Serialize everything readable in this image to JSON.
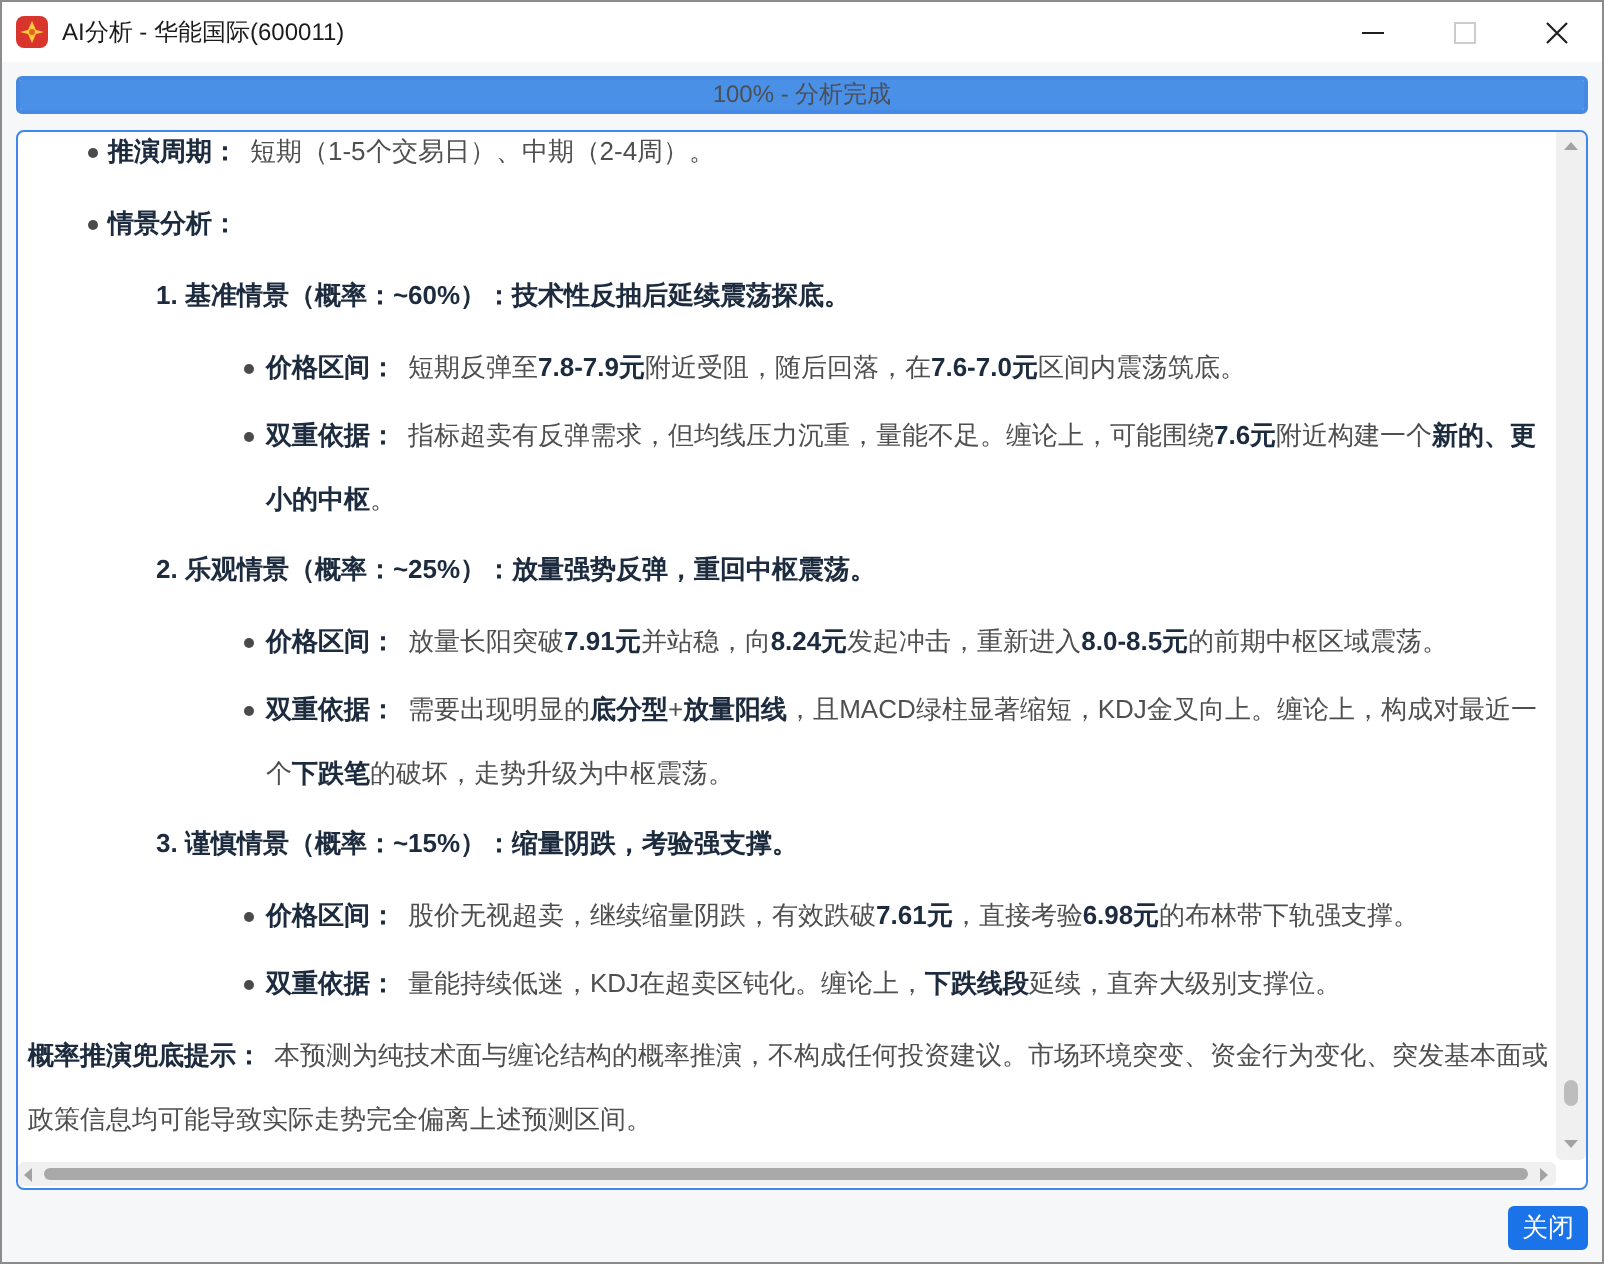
{
  "window": {
    "title": "AI分析 - 华能国际(600011)",
    "controls": [
      {
        "kind": "minimize",
        "disabled": false
      },
      {
        "kind": "maximize",
        "disabled": true
      },
      {
        "kind": "close",
        "disabled": false
      }
    ]
  },
  "progress": {
    "level": 1,
    "label": "100% - 分析完成"
  },
  "report": {
    "items": [
      {
        "label": "推演周期：",
        "text": "短期（1-5个交易日）、中期（2-4周）。"
      },
      {
        "label": "情景分析：",
        "scenarios": [
          {
            "title": "1. 基准情景（概率：~60%）：技术性反抽后延续震荡探底。",
            "points": [
              {
                "label": "价格区间：",
                "text": "短期反弹至**7.8-7.9元**附近受阻，随后回落，在**7.6-7.0元**区间内震荡筑底。"
              },
              {
                "label": "双重依据：",
                "text": "指标超卖有反弹需求，但均线压力沉重，量能不足。缠论上，可能围绕**7.6元**附近构建一个**新的、更小的中枢**。"
              }
            ]
          },
          {
            "title": "2. 乐观情景（概率：~25%）：放量强势反弹，重回中枢震荡。",
            "points": [
              {
                "label": "价格区间：",
                "text": "放量长阳突破**7.91元**并站稳，向**8.24元**发起冲击，重新进入**8.0-8.5元**的前期中枢区域震荡。"
              },
              {
                "label": "双重依据：",
                "text": "需要出现明显的**底分型**+**放量阳线**，且MACD绿柱显著缩短，KDJ金叉向上。缠论上，构成对最近一个**下跌笔**的破坏，走势升级为中枢震荡。"
              }
            ]
          },
          {
            "title": "3. 谨慎情景（概率：~15%）：缩量阴跌，考验强支撑。",
            "points": [
              {
                "label": "价格区间：",
                "text": "股价无视超卖，继续缩量阴跌，有效跌破**7.61元**，直接考验**6.98元**的布林带下轨强支撑。"
              },
              {
                "label": "双重依据：",
                "text": "量能持续低迷，KDJ在超卖区钝化。缠论上，**下跌线段**延续，直奔大级别支撑位。"
              }
            ]
          }
        ]
      }
    ],
    "note": {
      "label": "概率推演兜底提示：",
      "text": "本预测为纯技术面与缠论结构的概率推演，不构成任何投资建议。市场环境突变、资金行为变化、突发基本面或政策信息均可能导致实际走势完全偏离上述预测区间。"
    }
  },
  "buttons": [
    {
      "label": "关闭"
    }
  ]
}
